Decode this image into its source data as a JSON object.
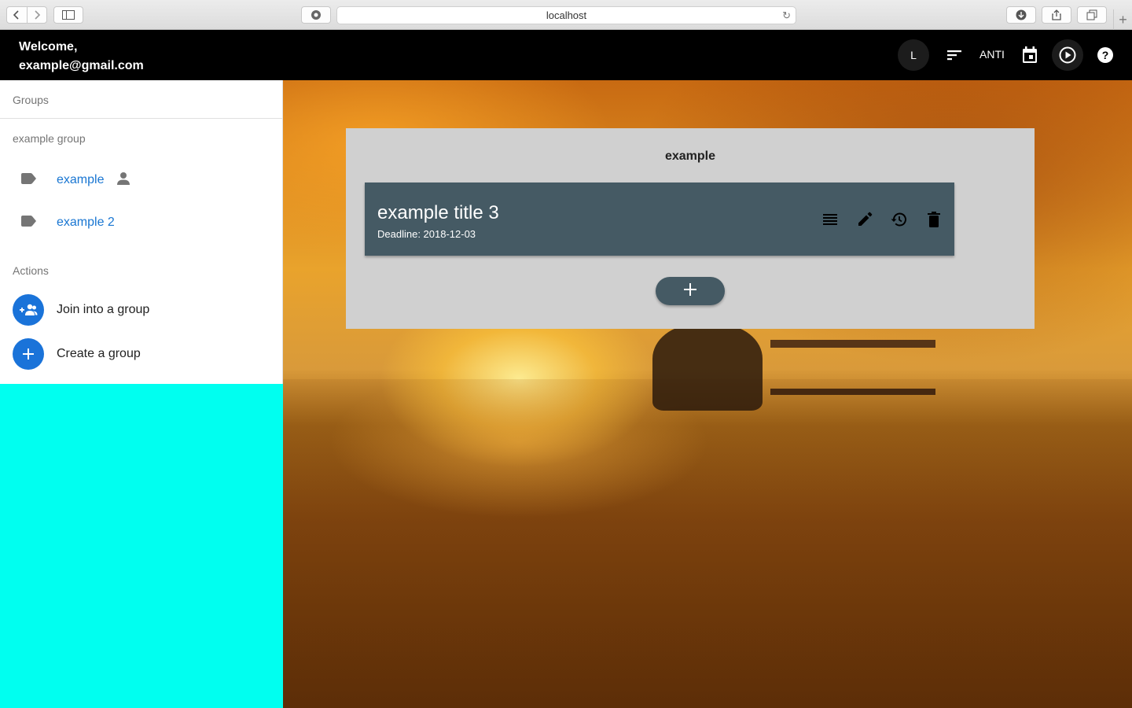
{
  "browser": {
    "url": "localhost",
    "icons": [
      "back-icon",
      "forward-icon",
      "sidebar-icon",
      "extension-icon",
      "reload-icon",
      "download-icon",
      "share-icon",
      "tabs-icon",
      "new-tab-icon"
    ]
  },
  "header": {
    "welcome_line1": "Welcome,",
    "welcome_line2": "example@gmail.com",
    "avatar_letter": "L",
    "anti_label": "ANTI",
    "icons": [
      "sort-icon",
      "calendar-icon",
      "play-circle-icon",
      "help-icon"
    ]
  },
  "sidebar": {
    "groups_heading": "Groups",
    "group_name": "example group",
    "items": [
      {
        "label": "example",
        "icon": "label-icon",
        "owner_icon": "person-icon"
      },
      {
        "label": "example 2",
        "icon": "label-icon"
      }
    ],
    "actions_heading": "Actions",
    "actions": [
      {
        "label": "Join into a group",
        "icon": "group-add-icon"
      },
      {
        "label": "Create a group",
        "icon": "add-icon"
      }
    ]
  },
  "main": {
    "panel_title": "example",
    "task": {
      "title": "example title 3",
      "deadline": "Deadline: 2018-12-03",
      "icons": [
        "list-icon",
        "edit-icon",
        "history-icon",
        "delete-icon"
      ]
    },
    "add_button_icon": "add-icon"
  },
  "colors": {
    "accent": "#1a73d9",
    "card": "#455a64",
    "panel": "#d0d0d0",
    "link": "#1976d2",
    "sidebar_filler": "#00fff0"
  }
}
